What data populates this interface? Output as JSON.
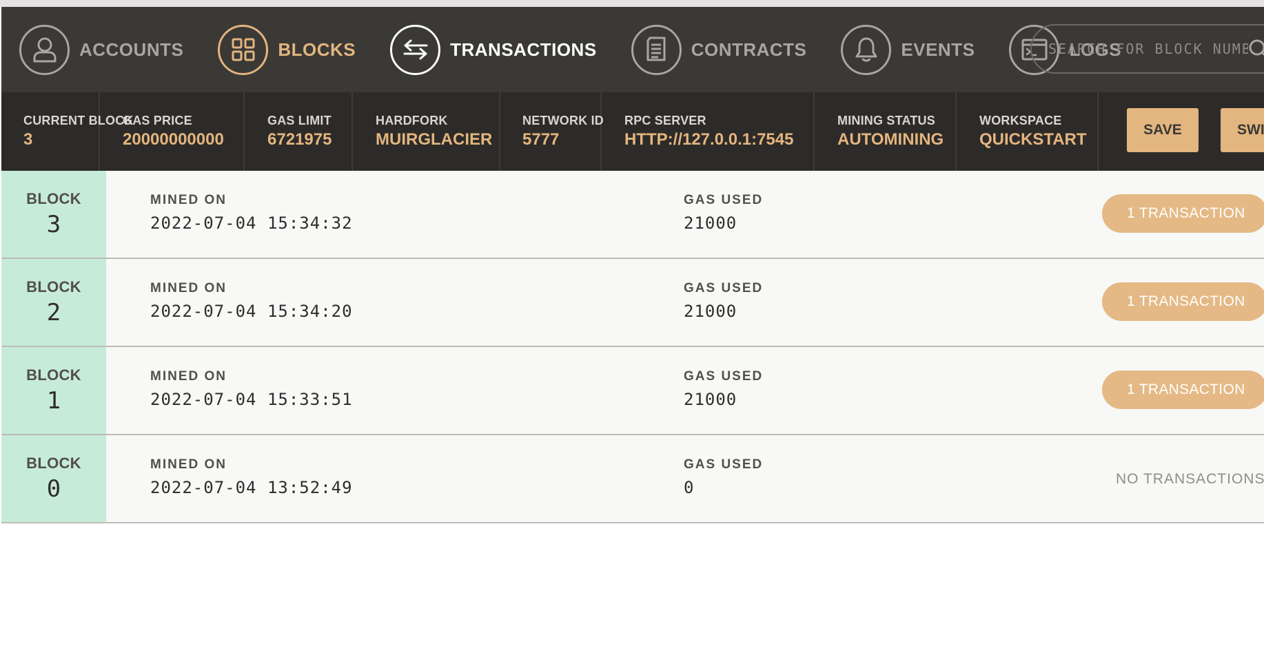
{
  "nav": {
    "items": [
      {
        "label": "ACCOUNTS",
        "icon": "user-icon",
        "state": "inactive"
      },
      {
        "label": "BLOCKS",
        "icon": "grid-icon",
        "state": "active"
      },
      {
        "label": "TRANSACTIONS",
        "icon": "swap-arrows-icon",
        "state": "hover"
      },
      {
        "label": "CONTRACTS",
        "icon": "document-icon",
        "state": "inactive"
      },
      {
        "label": "EVENTS",
        "icon": "bell-icon",
        "state": "inactive"
      },
      {
        "label": "LOGS",
        "icon": "terminal-icon",
        "state": "inactive"
      }
    ],
    "search_placeholder": "SEARCH FOR BLOCK NUMBERS OR TX HASHES"
  },
  "status": {
    "current_block": {
      "label": "CURRENT BLOCK",
      "value": "3"
    },
    "gas_price": {
      "label": "GAS PRICE",
      "value": "20000000000"
    },
    "gas_limit": {
      "label": "GAS LIMIT",
      "value": "6721975"
    },
    "hardfork": {
      "label": "HARDFORK",
      "value": "MUIRGLACIER"
    },
    "network_id": {
      "label": "NETWORK ID",
      "value": "5777"
    },
    "rpc_server": {
      "label": "RPC SERVER",
      "value": "HTTP://127.0.0.1:7545"
    },
    "mining_status": {
      "label": "MINING STATUS",
      "value": "AUTOMINING"
    },
    "workspace": {
      "label": "WORKSPACE",
      "value": "QUICKSTART"
    },
    "save_label": "SAVE",
    "switch_label": "SWI"
  },
  "blocks": [
    {
      "label": "BLOCK",
      "number": "3",
      "mined_label": "MINED ON",
      "mined_on": "2022-07-04 15:34:32",
      "gas_label": "GAS USED",
      "gas_used": "21000",
      "tx": "1 TRANSACTION"
    },
    {
      "label": "BLOCK",
      "number": "2",
      "mined_label": "MINED ON",
      "mined_on": "2022-07-04 15:34:20",
      "gas_label": "GAS USED",
      "gas_used": "21000",
      "tx": "1 TRANSACTION"
    },
    {
      "label": "BLOCK",
      "number": "1",
      "mined_label": "MINED ON",
      "mined_on": "2022-07-04 15:33:51",
      "gas_label": "GAS USED",
      "gas_used": "21000",
      "tx": "1 TRANSACTION"
    },
    {
      "label": "BLOCK",
      "number": "0",
      "mined_label": "MINED ON",
      "mined_on": "2022-07-04 13:52:49",
      "gas_label": "GAS USED",
      "gas_used": "0",
      "tx": "NO TRANSACTIONS"
    }
  ],
  "colors": {
    "nav_bg": "#3b3936",
    "status_bg": "#2d2b29",
    "accent": "#e3b57f",
    "block_cell": "#c6ebd9"
  }
}
